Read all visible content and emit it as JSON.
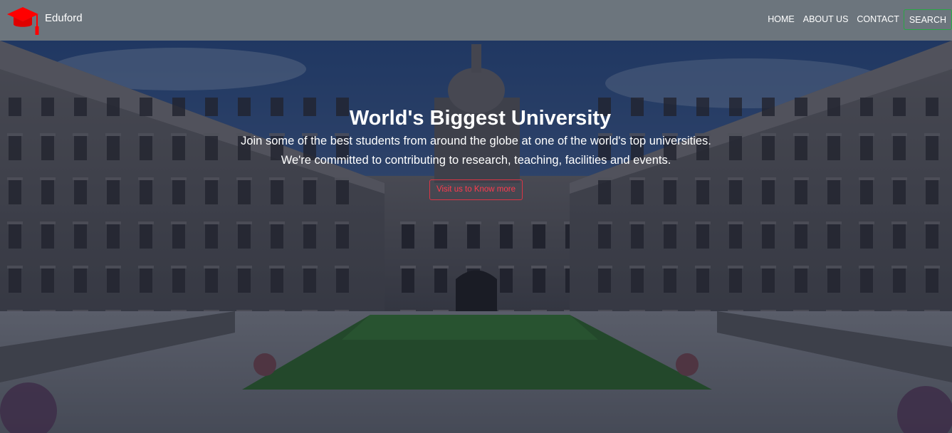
{
  "brand": {
    "name": "Eduford",
    "icon": "graduation-cap-icon",
    "icon_color": "#ff0000"
  },
  "nav": {
    "links": [
      {
        "label": "HOME"
      },
      {
        "label": "ABOUT US"
      },
      {
        "label": "CONTACT"
      }
    ],
    "search_label": "SEARCH"
  },
  "hero": {
    "title": "World's Biggest University",
    "line1": "Join some of the best students from around the globe at one of the world's top universities.",
    "line2": "We're committed to contributing to research, teaching, facilities and events.",
    "button_label": "Visit us to Know more",
    "background": "university-quadrangle-photo"
  },
  "colors": {
    "navbar": "#6c757d",
    "search_border": "#28a745",
    "button_accent": "#dc3545"
  }
}
